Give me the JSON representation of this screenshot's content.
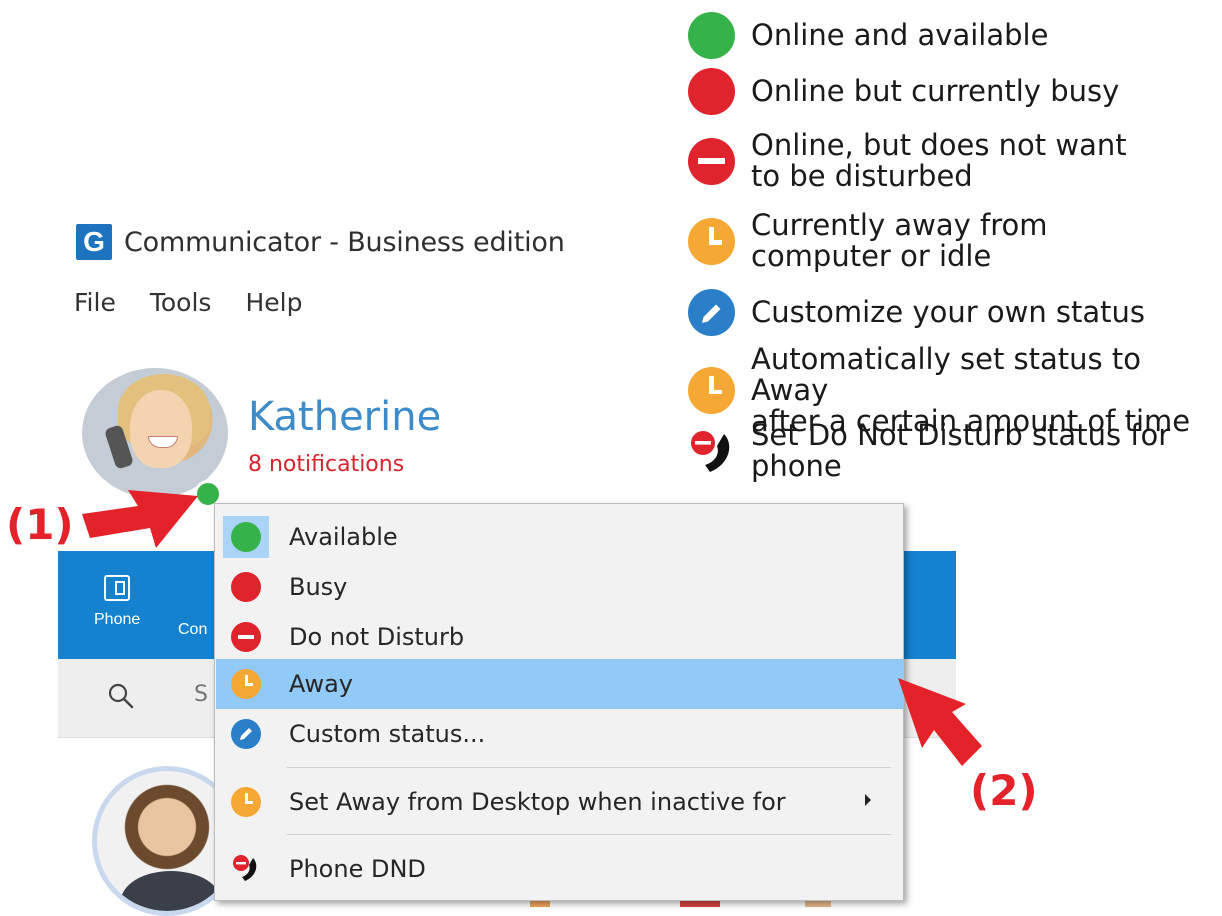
{
  "window": {
    "title": "Communicator - Business edition",
    "logo_letter": "G"
  },
  "menubar": {
    "items": [
      "File",
      "Tools",
      "Help"
    ]
  },
  "profile": {
    "name": "Katherine",
    "notifications": "8 notifications",
    "status_color": "#35b34a"
  },
  "nav": {
    "items": [
      {
        "label": "Phone",
        "icon": "phone-desk-icon"
      },
      {
        "label": "Con",
        "icon": "contacts-icon"
      }
    ]
  },
  "search": {
    "placeholder": "S"
  },
  "status_menu": {
    "items": [
      {
        "label": "Available",
        "icon": "green-dot-icon",
        "selected": true
      },
      {
        "label": "Busy",
        "icon": "red-dot-icon"
      },
      {
        "label": "Do not Disturb",
        "icon": "do-not-disturb-icon"
      },
      {
        "label": "Away",
        "icon": "clock-icon",
        "highlighted": true
      },
      {
        "label": "Custom status...",
        "icon": "pencil-icon"
      },
      {
        "label": "Set Away from Desktop when inactive for",
        "icon": "clock-icon",
        "has_submenu": true
      },
      {
        "label": "Phone DND",
        "icon": "phone-dnd-icon"
      }
    ]
  },
  "legend": {
    "items": [
      {
        "text": "Online and available",
        "icon": "green-dot-icon"
      },
      {
        "text": "Online but currently busy",
        "icon": "red-dot-icon"
      },
      {
        "text_lines": [
          "Online, but does not want",
          "to be disturbed"
        ],
        "icon": "do-not-disturb-icon"
      },
      {
        "text_lines": [
          "Currently away from",
          "computer or idle"
        ],
        "icon": "clock-icon"
      },
      {
        "text": "Customize your own status",
        "icon": "pencil-icon"
      },
      {
        "text_lines": [
          "Automatically set status to Away",
          "after a certain amount of time"
        ],
        "icon": "clock-icon"
      },
      {
        "text_lines": [
          "Set Do Not Disturb status for",
          "phone"
        ],
        "icon": "phone-dnd-icon"
      }
    ]
  },
  "annotations": {
    "step1": "(1)",
    "step2": "(2)"
  },
  "colors": {
    "green": "#35b34a",
    "red": "#e0242d",
    "orange": "#f5a834",
    "blue": "#2b7fc8",
    "nav_blue": "#1582cf",
    "highlight": "#91c9f7",
    "annotation_red": "#e3222a"
  }
}
